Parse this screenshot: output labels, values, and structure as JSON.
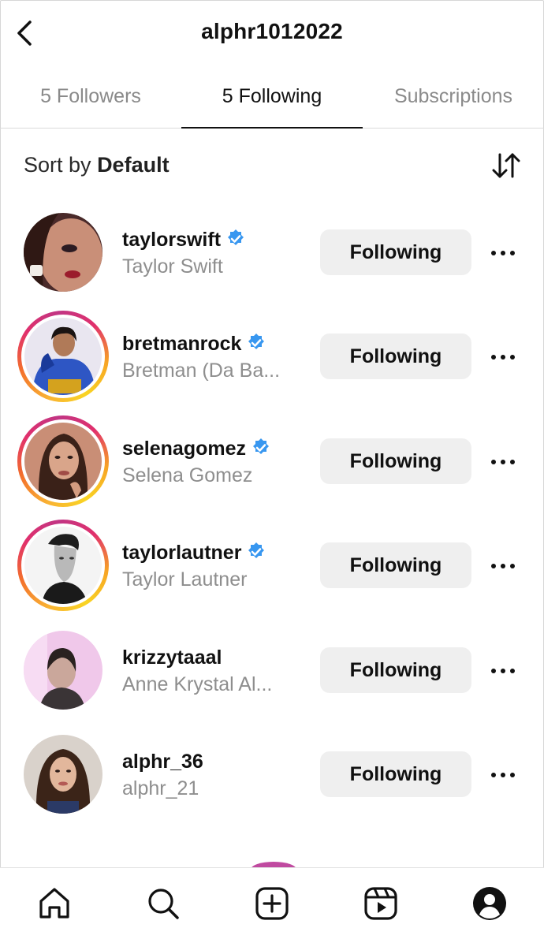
{
  "header": {
    "title": "alphr1012022"
  },
  "tabs": [
    {
      "label": "5 Followers",
      "active": false
    },
    {
      "label": "5 Following",
      "active": true
    },
    {
      "label": "Subscriptions",
      "active": false
    }
  ],
  "sort": {
    "prefix": "Sort by",
    "value": "Default"
  },
  "rows": [
    {
      "username": "taylorswift",
      "fullname": "Taylor Swift",
      "verified": true,
      "story_ring": false,
      "button": "Following"
    },
    {
      "username": "bretmanrock",
      "fullname": "Bretman (Da Ba...",
      "verified": true,
      "story_ring": true,
      "button": "Following"
    },
    {
      "username": "selenagomez",
      "fullname": "Selena Gomez",
      "verified": true,
      "story_ring": true,
      "button": "Following"
    },
    {
      "username": "taylorlautner",
      "fullname": "Taylor Lautner",
      "verified": true,
      "story_ring": true,
      "button": "Following"
    },
    {
      "username": "krizzytaaal",
      "fullname": "Anne Krystal Al...",
      "verified": false,
      "story_ring": false,
      "button": "Following"
    },
    {
      "username": "alphr_36",
      "fullname": "alphr_21",
      "verified": false,
      "story_ring": false,
      "button": "Following"
    }
  ],
  "colors": {
    "verified": "#3897f0",
    "story_ring": [
      "#f9b233",
      "#e1306c",
      "#c13584"
    ],
    "button_bg": "#efefef"
  },
  "nav": [
    "home-icon",
    "search-icon",
    "create-icon",
    "reels-icon",
    "profile-icon"
  ]
}
